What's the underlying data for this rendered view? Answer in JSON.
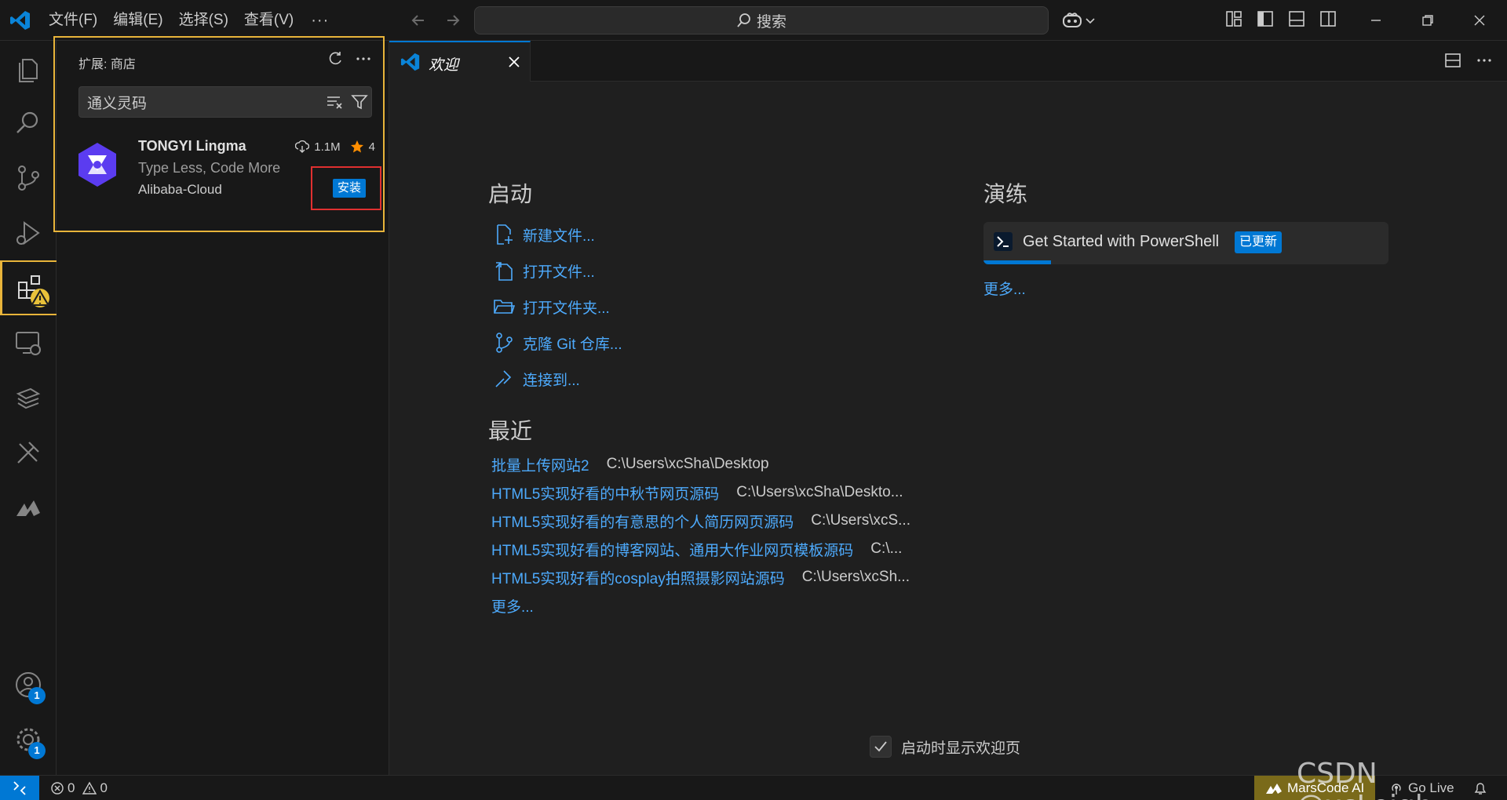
{
  "titlebar": {
    "menu": [
      "文件(F)",
      "编辑(E)",
      "选择(S)",
      "查看(V)"
    ],
    "more": "···",
    "search_label": "搜索"
  },
  "activity": {
    "accounts_badge": "1",
    "manage_badge": "1"
  },
  "extensions": {
    "header": "扩展: 商店",
    "search_value": "通义灵码",
    "result": {
      "name": "TONGYI Lingma",
      "downloads": "1.1M",
      "rating": "4",
      "description": "Type Less, Code More",
      "publisher": "Alibaba-Cloud",
      "install_label": "安装"
    }
  },
  "editor": {
    "tab_label": "欢迎"
  },
  "welcome": {
    "start_title": "启动",
    "start_items": [
      "新建文件...",
      "打开文件...",
      "打开文件夹...",
      "克隆 Git 仓库...",
      "连接到..."
    ],
    "recent_title": "最近",
    "recent_items": [
      {
        "name": "批量上传网站2",
        "path": "C:\\Users\\xcSha\\Desktop"
      },
      {
        "name": "HTML5实现好看的中秋节网页源码",
        "path": "C:\\Users\\xcSha\\Deskto..."
      },
      {
        "name": "HTML5实现好看的有意思的个人简历网页源码",
        "path": "C:\\Users\\xcS..."
      },
      {
        "name": "HTML5实现好看的博客网站、通用大作业网页模板源码",
        "path": "C:\\..."
      },
      {
        "name": "HTML5实现好看的cosplay拍照摄影网站源码",
        "path": "C:\\Users\\xcSh..."
      }
    ],
    "recent_more": "更多...",
    "walkthrough_title": "演练",
    "walkthrough_item": "Get Started with PowerShell",
    "walkthrough_badge": "已更新",
    "walkthrough_more": "更多...",
    "show_on_startup": "启动时显示欢迎页"
  },
  "statusbar": {
    "errors": "0",
    "warnings": "0",
    "marscode": "MarsCode AI",
    "golive": "Go Live"
  },
  "watermark": "CSDN @xcLeigh",
  "colors": {
    "accent": "#0078d4",
    "link": "#4daafc",
    "highlight_border": "#e8b43a",
    "red_box": "#e03030"
  }
}
